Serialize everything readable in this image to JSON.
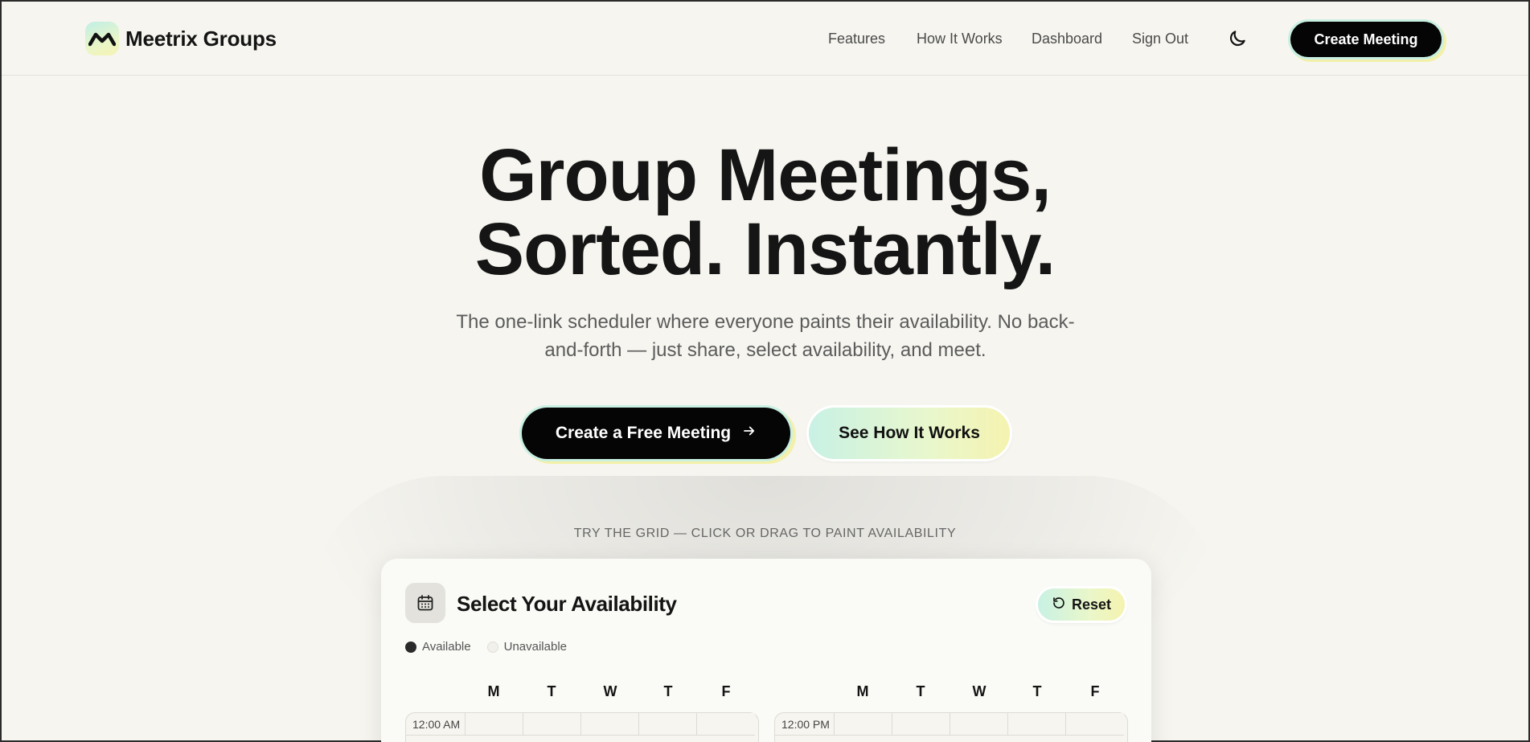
{
  "header": {
    "brand": "Meetrix Groups",
    "nav": [
      "Features",
      "How It Works",
      "Dashboard",
      "Sign Out"
    ],
    "theme_toggle_icon": "moon-icon",
    "cta": "Create Meeting"
  },
  "hero": {
    "title_line1": "Group Meetings,",
    "title_line2": "Sorted. Instantly.",
    "subtitle_line1": "The one-link scheduler where everyone paints their availability. No back-",
    "subtitle_line2": "and-forth — just share, select availability, and meet.",
    "primary_cta": "Create a Free Meeting",
    "primary_cta_icon": "arrow-right-icon",
    "secondary_cta": "See How It Works"
  },
  "demo": {
    "hint": "TRY THE GRID — CLICK OR DRAG TO PAINT AVAILABILITY",
    "card_title": "Select Your Availability",
    "card_icon": "calendar-icon",
    "reset": "Reset",
    "reset_icon": "reset-icon",
    "legend": {
      "available": "Available",
      "unavailable": "Unavailable"
    },
    "grids": [
      {
        "days": [
          "M",
          "T",
          "W",
          "T",
          "F"
        ],
        "first_time": "12:00 AM"
      },
      {
        "days": [
          "M",
          "T",
          "W",
          "T",
          "F"
        ],
        "first_time": "12:00 PM"
      }
    ]
  },
  "colors": {
    "background": "#f6f5f0",
    "primary": "#050505",
    "accent_mint": "#c8f1e4",
    "accent_lemon": "#f5f3b0"
  }
}
